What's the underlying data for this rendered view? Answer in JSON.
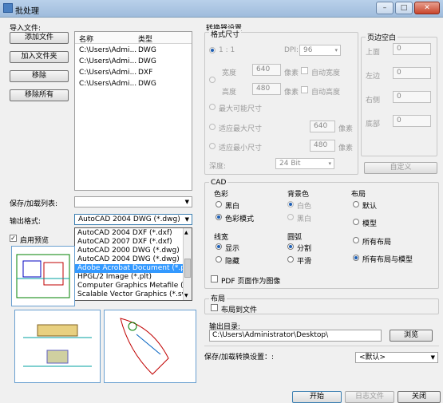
{
  "window": {
    "title": "批处理",
    "min": "–",
    "max": "□",
    "close": "✕"
  },
  "left": {
    "import_label": "导入文件:",
    "buttons": {
      "add_file": "添加文件",
      "add_folder": "加入文件夹",
      "remove": "移除",
      "remove_all": "移除所有"
    },
    "list_headers": {
      "name": "名称",
      "type": "类型"
    },
    "files": [
      {
        "name": "C:\\Users\\Admi...",
        "type": "DWG"
      },
      {
        "name": "C:\\Users\\Admi...",
        "type": "DWG"
      },
      {
        "name": "C:\\Users\\Admi...",
        "type": "DXF"
      },
      {
        "name": "C:\\Users\\Admi...",
        "type": "DWG"
      }
    ],
    "save_load_list_label": "保存/加载列表:",
    "output_format_label": "输出格式:",
    "output_format_value": "AutoCAD 2004 DWG (*.dwg)",
    "format_options": [
      "AutoCAD 2004 DXF (*.dxf)",
      "AutoCAD 2007 DXF (*.dxf)",
      "AutoCAD 2000 DWG (*.dwg)",
      "AutoCAD 2004 DWG (*.dwg)",
      "Adobe Acrobat Document (*.pdf)",
      "HPGL/2 Image (*.plt)",
      "Computer Graphics Metafile (*.cg",
      "Scalable Vector Graphics (*.svg)"
    ],
    "enable_preview_label": "启用预览"
  },
  "converter": {
    "title": "转换器设置",
    "format_size_title": "格式尺寸",
    "ratio": "1 : 1",
    "dpi_label": "DPI:",
    "dpi_value": "96",
    "width_label": "宽度",
    "width_value": "640",
    "pixels": "像素",
    "auto_width": "自动宽度",
    "height_label": "高度",
    "height_value": "480",
    "auto_height": "自动高度",
    "max_size": "最大可能尺寸",
    "fit_max": "适应最大尺寸",
    "fit_max_value": "640",
    "fit_min": "适应最小尺寸",
    "fit_min_value": "480",
    "depth_label": "深度:",
    "depth_value": "24 Bit",
    "margins_title": "页边空白",
    "margin_top": "上面",
    "margin_left": "左边",
    "margin_right": "右侧",
    "margin_bottom": "底部",
    "margin_top_value": "0",
    "margin_left_value": "0",
    "margin_right_value": "0",
    "margin_bottom_value": "0",
    "custom_button": "自定义"
  },
  "cad": {
    "title": "CAD",
    "color_title": "色彩",
    "black_white": "黑白",
    "color_mode": "色彩模式",
    "bg_title": "背景色",
    "bg_white": "白色",
    "bg_black": "黑白",
    "layout_title": "布局",
    "layout_default": "默认",
    "layout_model": "模型",
    "layout_all": "所有布局",
    "layout_all_model": "所有布局与模型",
    "linewidth_title": "线宽",
    "show": "显示",
    "hide": "隐藏",
    "arc_title": "圆弧",
    "segment": "分割",
    "smooth": "平滑",
    "pdf_page_image": "PDF 页面作为图像"
  },
  "layout2": {
    "title": "布局",
    "layout_to_file": "布局到文件"
  },
  "output": {
    "dir_label": "输出目录:",
    "dir_value": "C:\\Users\\Administrator\\Desktop\\",
    "browse": "浏览"
  },
  "save_load_settings": {
    "label": "保存/加载转换设置：:",
    "value": "<默认>"
  },
  "footer": {
    "start": "开始",
    "log": "日志文件",
    "close": "关闭"
  }
}
